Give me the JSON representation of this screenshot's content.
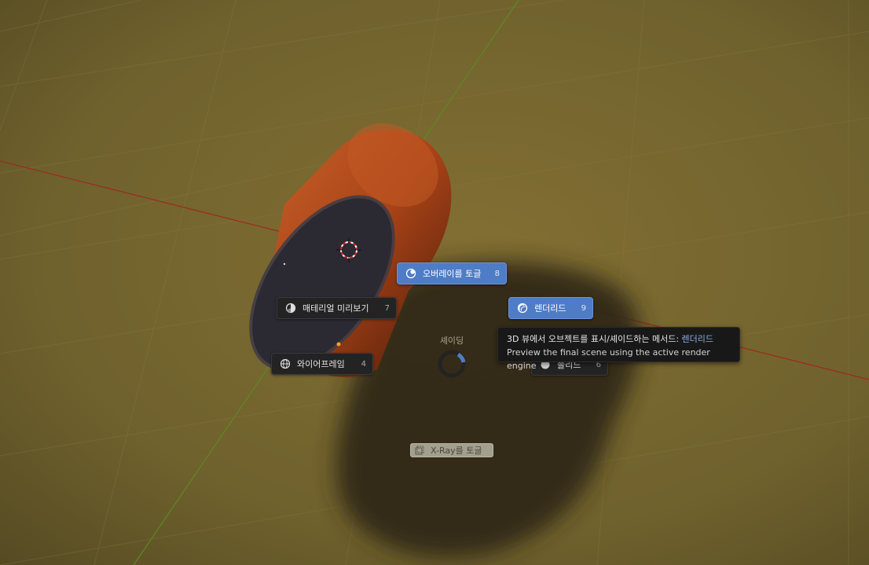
{
  "pie_menu": {
    "title": "셰이딩",
    "items": [
      {
        "id": "overlay",
        "label": "오버레이를 토글",
        "key": "8",
        "active": true,
        "icon": "overlay-icon"
      },
      {
        "id": "material",
        "label": "매테리얼 미리보기",
        "key": "7",
        "active": false,
        "icon": "material-preview-icon"
      },
      {
        "id": "rendered",
        "label": "렌더리드",
        "key": "9",
        "active": true,
        "icon": "rendered-icon"
      },
      {
        "id": "wireframe",
        "label": "와이어프레임",
        "key": "4",
        "active": false,
        "icon": "wireframe-icon"
      },
      {
        "id": "solid",
        "label": "솔리드",
        "key": "6",
        "active": false,
        "icon": "solid-icon"
      }
    ],
    "xray_label": "X-Ray를 토글"
  },
  "tooltip": {
    "line1_prefix": "3D 뷰에서 오브젝트를 표시/셰이드하는 메서드: ",
    "line1_value": "렌더리드",
    "line2": "Preview the final scene using the active render engine"
  },
  "colors": {
    "floor": "#6e5f2b",
    "cylinder_side": "#b8501f",
    "cylinder_cap": "#2c2a33",
    "active_item": "#4f7cc6",
    "x_axis": "#9c2a22",
    "y_axis": "#5a8a24"
  }
}
